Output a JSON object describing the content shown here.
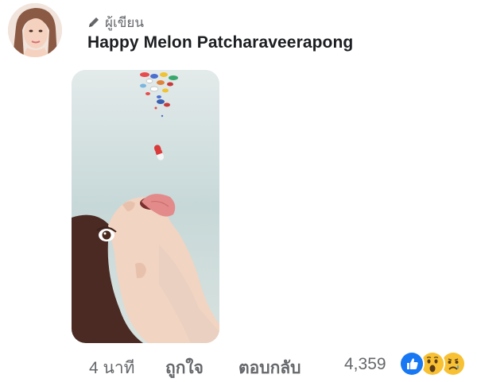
{
  "comment": {
    "author_badge": "ผู้เขียน",
    "author_name": "Happy Melon Patcharaveerapong"
  },
  "actions": {
    "time": "4 นาที",
    "like_label": "ถูกใจ",
    "reply_label": "ตอบกลับ",
    "reaction_count": "4,359"
  },
  "icons": {
    "badge": "pencil-icon",
    "reactions": [
      "like-reaction-icon",
      "wow-reaction-icon",
      "sad-reaction-icon"
    ]
  },
  "colors": {
    "like_blue": "#1877f2",
    "reaction_yellow": "#f7c133",
    "secondary_text": "#65676b"
  }
}
